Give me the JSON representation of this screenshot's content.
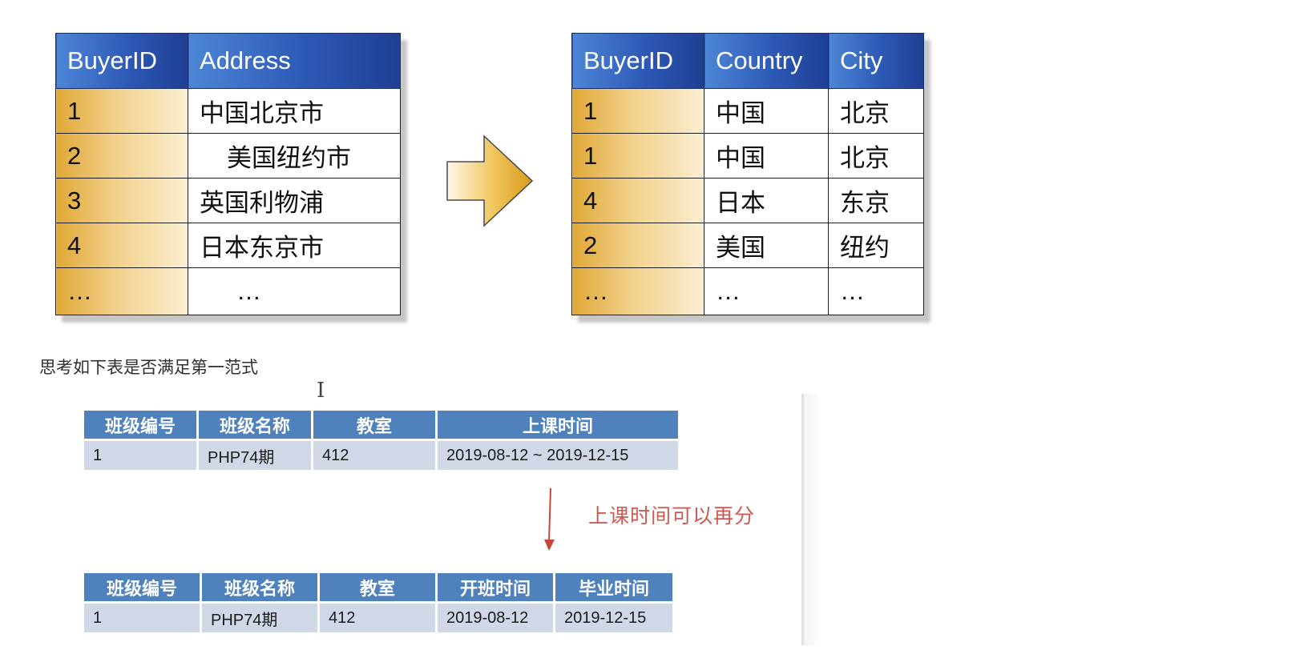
{
  "buyer_address_table": {
    "headers": [
      "BuyerID",
      "Address"
    ],
    "rows": [
      [
        "1",
        "中国北京市"
      ],
      [
        "2",
        "美国纽约市"
      ],
      [
        "3",
        "英国利物浦"
      ],
      [
        "4",
        "日本东京市"
      ],
      [
        "…",
        "…"
      ]
    ]
  },
  "buyer_city_table": {
    "headers": [
      "BuyerID",
      "Country",
      "City"
    ],
    "rows": [
      [
        "1",
        "中国",
        "北京"
      ],
      [
        "1",
        "中国",
        "北京"
      ],
      [
        "4",
        "日本",
        "东京"
      ],
      [
        "2",
        "美国",
        "纽约"
      ],
      [
        "…",
        "…",
        "…"
      ]
    ]
  },
  "question": "思考如下表是否满足第一范式",
  "cursor_glyph": "I",
  "class_table_before": {
    "headers": [
      "班级编号",
      "班级名称",
      "教室",
      "上课时间"
    ],
    "rows": [
      [
        "1",
        "PHP74期",
        "412",
        "2019-08-12 ~ 2019-12-15"
      ]
    ]
  },
  "split_note": "上课时间可以再分",
  "class_table_after": {
    "headers": [
      "班级编号",
      "班级名称",
      "教室",
      "开班时间",
      "毕业时间"
    ],
    "rows": [
      [
        "1",
        "PHP74期",
        "412",
        "2019-08-12",
        "2019-12-15"
      ]
    ]
  },
  "colors": {
    "header_blue": "#4f81bd",
    "cell_light_blue": "#d0d8e8",
    "id_gold": "#e0a837",
    "note_red": "#cf5a52"
  }
}
